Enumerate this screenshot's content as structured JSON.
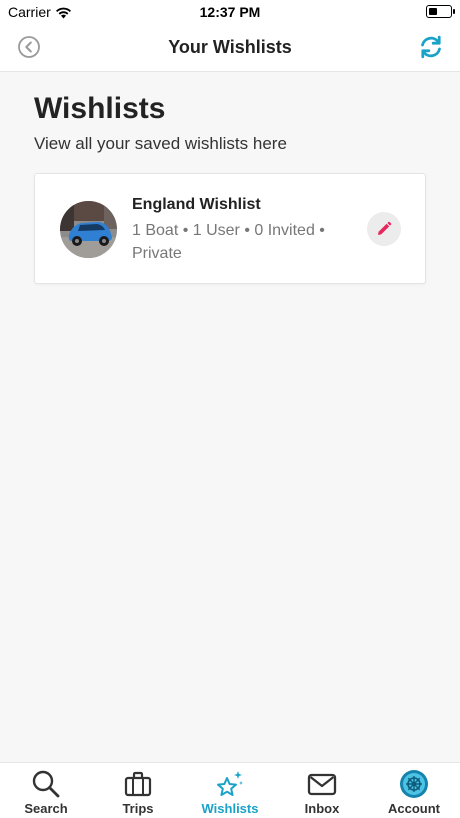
{
  "status_bar": {
    "carrier": "Carrier",
    "time": "12:37 PM",
    "battery_level": 0.35
  },
  "nav": {
    "title": "Your Wishlists",
    "back_icon": "chevron-left-circle-icon",
    "refresh_icon": "refresh-icon"
  },
  "page": {
    "title": "Wishlists",
    "subtitle": "View all your saved wishlists here"
  },
  "wishlists": [
    {
      "name": "England Wishlist",
      "meta": "1 Boat • 1 User • 0 Invited • Private",
      "thumb_icon": "car-photo-thumbnail",
      "edit_icon": "pencil-icon"
    }
  ],
  "tabs": [
    {
      "label": "Search",
      "icon": "search-icon",
      "active": false
    },
    {
      "label": "Trips",
      "icon": "briefcase-icon",
      "active": false
    },
    {
      "label": "Wishlists",
      "icon": "sparkle-stars-icon",
      "active": true
    },
    {
      "label": "Inbox",
      "icon": "envelope-icon",
      "active": false
    },
    {
      "label": "Account",
      "icon": "avatar-icon",
      "active": false
    }
  ],
  "colors": {
    "accent": "#1aa3c8",
    "edit_pencil": "#e8265e",
    "background": "#f7f7f7"
  }
}
